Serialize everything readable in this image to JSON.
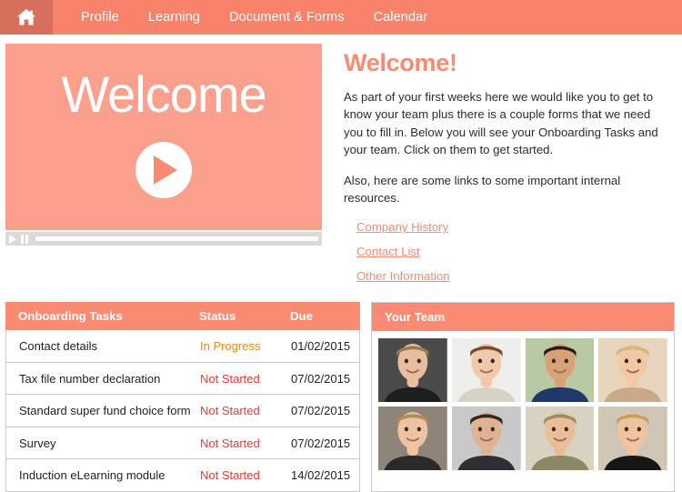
{
  "nav": {
    "home_icon": "home-icon",
    "items": [
      {
        "label": "Profile"
      },
      {
        "label": "Learning"
      },
      {
        "label": "Document & Forms"
      },
      {
        "label": "Calendar"
      }
    ]
  },
  "video": {
    "title": "Welcome",
    "play_icon": "play-icon",
    "controls": {
      "play_icon": "play-icon",
      "pause_icon": "pause-icon",
      "progress_percent": 0
    }
  },
  "welcome": {
    "heading": "Welcome!",
    "paragraph": "As part of your first weeks here we would like you to get to know your team plus there is a couple forms that we need you to fill in. Below you will see your Onboarding Tasks and your team. Click on them to get started.",
    "links_intro": "Also, here are some links to some important internal resources.",
    "links": [
      {
        "label": "Company History"
      },
      {
        "label": "Contact List"
      },
      {
        "label": "Other Information"
      }
    ]
  },
  "tasks": {
    "columns": [
      "Onboarding Tasks",
      "Status",
      "Due"
    ],
    "rows": [
      {
        "task": "Contact details",
        "status": "In Progress",
        "status_state": "in-progress",
        "due": "01/02/2015"
      },
      {
        "task": "Tax file number declaration",
        "status": "Not Started",
        "status_state": "not-started",
        "due": "07/02/2015"
      },
      {
        "task": "Standard super fund choice form",
        "status": "Not Started",
        "status_state": "not-started",
        "due": "07/02/2015"
      },
      {
        "task": "Survey",
        "status": "Not Started",
        "status_state": "not-started",
        "due": "07/02/2015"
      },
      {
        "task": "Induction eLearning module",
        "status": "Not Started",
        "status_state": "not-started",
        "due": "14/02/2015"
      }
    ]
  },
  "team": {
    "title": "Your Team",
    "members": [
      {
        "avatar": "avatar-man-glasses-dark-bg",
        "bg": "#4a4a4a",
        "skin": "#e9bda0",
        "hair": "#9a7b52",
        "shirt": "#1e1e1e"
      },
      {
        "avatar": "avatar-woman-brown-hair",
        "bg": "#eeeeea",
        "skin": "#f0c9ab",
        "hair": "#7a4a2e",
        "shirt": "#d8d2c6"
      },
      {
        "avatar": "avatar-woman-navy-top",
        "bg": "#b9c9a4",
        "skin": "#d8a276",
        "hair": "#2a1a12",
        "shirt": "#22386b"
      },
      {
        "avatar": "avatar-woman-blonde-smiling",
        "bg": "#e7d6bd",
        "skin": "#f2c9a6",
        "hair": "#d8b47a",
        "shirt": "#c9a98a"
      },
      {
        "avatar": "avatar-young-man-blond",
        "bg": "#8e8479",
        "skin": "#eec3a2",
        "hair": "#b08c52",
        "shirt": "#2a2a2a"
      },
      {
        "avatar": "avatar-man-curly-glasses",
        "bg": "#c9c9c9",
        "skin": "#e0b294",
        "hair": "#2e2722",
        "shirt": "#2f2f33"
      },
      {
        "avatar": "avatar-man-glasses-olive-tee",
        "bg": "#d8d2c2",
        "skin": "#e8bd99",
        "hair": "#a08a62",
        "shirt": "#8d8663"
      },
      {
        "avatar": "avatar-woman-blonde-black-top",
        "bg": "#cfc6b5",
        "skin": "#f0c3a0",
        "hair": "#c8a05e",
        "shirt": "#161616"
      }
    ]
  },
  "colors": {
    "brand_salmon": "#FB8A72",
    "nav_salmon": "#F9826B",
    "home_tile": "#D66F5C",
    "video_bg": "#FBA08C",
    "status_in_progress": "#F5880C",
    "status_not_started": "#F4362F",
    "border_gray": "#C9C9C9",
    "control_bar": "#DADADA"
  }
}
